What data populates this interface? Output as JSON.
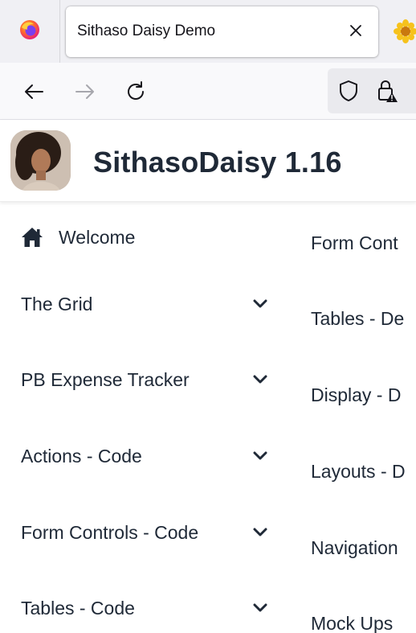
{
  "browser": {
    "tab_title": "Sithaso Daisy Demo",
    "icons": [
      "firefox-icon",
      "close-icon",
      "sunflower-icon",
      "back-arrow-icon",
      "forward-arrow-icon",
      "reload-icon",
      "shield-icon",
      "lock-warning-icon"
    ]
  },
  "app": {
    "title": "SithasoDaisy 1.16"
  },
  "sidebar": {
    "items": [
      {
        "label": "Welcome",
        "icon": "home-icon"
      },
      {
        "label": "The Grid",
        "icon": "chevron-down-icon"
      },
      {
        "label": "PB Expense Tracker",
        "icon": "chevron-down-icon"
      },
      {
        "label": "Actions - Code",
        "icon": "chevron-down-icon"
      },
      {
        "label": "Form Controls - Code",
        "icon": "chevron-down-icon"
      },
      {
        "label": "Tables - Code",
        "icon": "chevron-down-icon"
      }
    ]
  },
  "rightcol": {
    "items": [
      {
        "label": "Form Cont"
      },
      {
        "label": "Tables - De"
      },
      {
        "label": "Display - D"
      },
      {
        "label": "Layouts - D"
      },
      {
        "label": "Navigation"
      },
      {
        "label": "Mock Ups"
      }
    ]
  }
}
